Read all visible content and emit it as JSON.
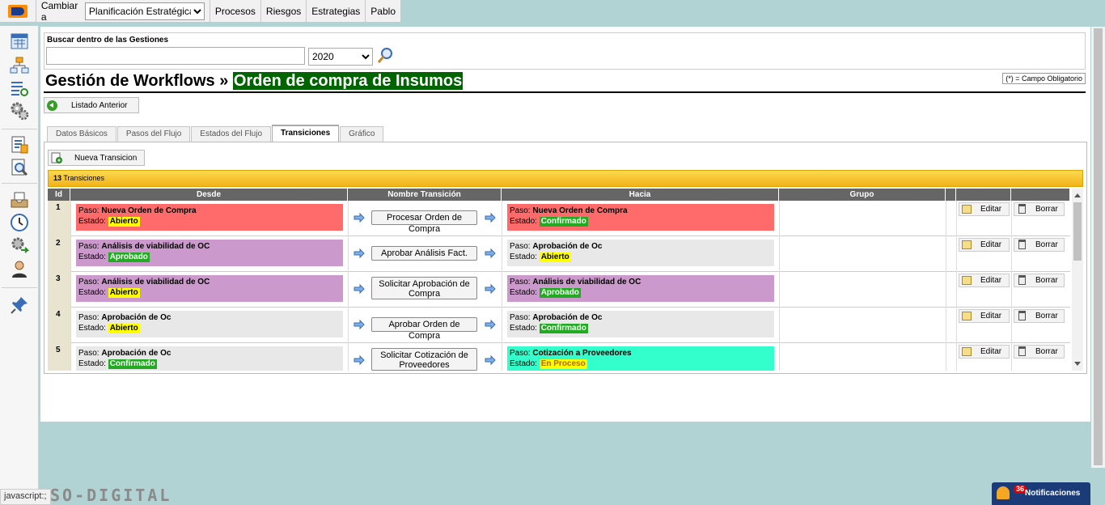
{
  "topbar": {
    "switch_label": "Cambiar a",
    "plan_selected": "Planificación Estratégica",
    "menu": [
      "Procesos",
      "Riesgos",
      "Estrategias",
      "Pablo"
    ]
  },
  "search": {
    "label": "Buscar dentro de las Gestiones",
    "value": "",
    "year": "2020"
  },
  "header": {
    "title_prefix": "Gestión de Workflows »",
    "title_highlight": "Orden de compra de Insumos",
    "required_note": "(*) = Campo Obligatorio"
  },
  "back_button": "Listado Anterior",
  "tabs": [
    "Datos Básicos",
    "Pasos del Flujo",
    "Estados del Flujo",
    "Transiciones",
    "Gráfico"
  ],
  "active_tab": "Transiciones",
  "new_button": "Nueva Transicion",
  "count": {
    "number": "13",
    "label": "Transiciones"
  },
  "table": {
    "columns": [
      "Id",
      "Desde",
      "Nombre Transición",
      "Hacia",
      "Grupo",
      "",
      "",
      ""
    ],
    "paso_label": "Paso:",
    "estado_label": "Estado:",
    "edit_label": "Editar",
    "delete_label": "Borrar",
    "rows": [
      {
        "id": "1",
        "from_step": "Nueva Orden de Compra",
        "from_state": "Abierto",
        "transition": "Procesar Orden de Compra",
        "to_step": "Nueva Orden de Compra",
        "to_state": "Confirmado",
        "group": ""
      },
      {
        "id": "2",
        "from_step": "Análisis de viabilidad de OC",
        "from_state": "Aprobado",
        "transition": "Aprobar Análisis Fact.",
        "to_step": "Aprobación de Oc",
        "to_state": "Abierto",
        "group": ""
      },
      {
        "id": "3",
        "from_step": "Análisis de viabilidad de OC",
        "from_state": "Abierto",
        "transition": "Solicitar Aprobación de Compra",
        "to_step": "Análisis de viabilidad de OC",
        "to_state": "Aprobado",
        "group": ""
      },
      {
        "id": "4",
        "from_step": "Aprobación de Oc",
        "from_state": "Abierto",
        "transition": "Aprobar Orden de Compra",
        "to_step": "Aprobación de Oc",
        "to_state": "Confirmado",
        "group": ""
      },
      {
        "id": "5",
        "from_step": "Aprobación de Oc",
        "from_state": "Confirmado",
        "transition": "Solicitar Cotización de Proveedores",
        "to_step": "Cotización a Proveedores",
        "to_state": "En Proceso",
        "group": ""
      }
    ]
  },
  "colors": {
    "step_nueva_orden": "#ff6b6b",
    "step_analisis": "#cc99cc",
    "step_aprobacion": "#e8e8e8",
    "step_cotizacion": "#33ffcc",
    "title_highlight_bg": "#006400"
  },
  "footer": {
    "status": "javascript:;",
    "brand": "SO-DIGITAL",
    "notif_count": "36",
    "notif_label": "Notificaciones"
  }
}
